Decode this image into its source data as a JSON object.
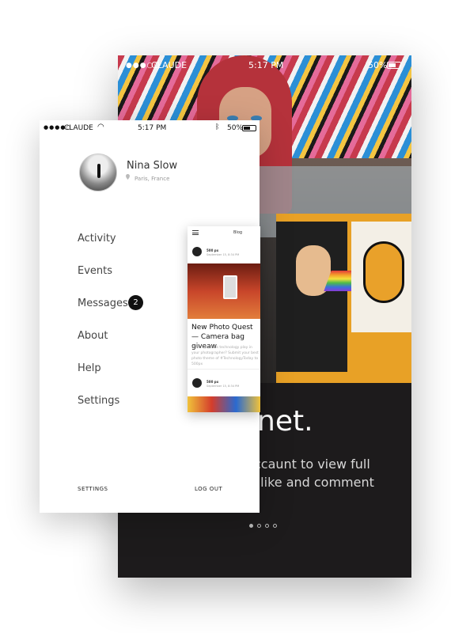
{
  "back_phone": {
    "status": {
      "carrier": "CLAUDE",
      "time": "5:17 PM",
      "battery": "50%"
    },
    "headline": "net.",
    "subline": "ccaunt to view full\n, like and comment",
    "pager": {
      "count": 4,
      "active": 0
    }
  },
  "front_phone": {
    "status": {
      "carrier": "CLAUDE",
      "time": "5:17 PM",
      "battery": "50%"
    },
    "profile": {
      "name": "Nina Slow",
      "location": "Paris, France"
    },
    "menu": [
      {
        "label": "Activity"
      },
      {
        "label": "Events"
      },
      {
        "label": "Messages",
        "badge": "2"
      },
      {
        "label": "About"
      },
      {
        "label": "Help"
      },
      {
        "label": "Settings"
      }
    ],
    "footer": {
      "settings": "SETTINGS",
      "logout": "LOG OUT"
    }
  },
  "blog_card": {
    "title": "Blog",
    "post1": {
      "points": "500 px",
      "date": "September 15, 8:34 PM"
    },
    "post_title": "New Photo Quest — Camera bag giveaw",
    "post_desc": "What role does technology play in your photographer? Submit your best photo theme of #TechnologyToday to 500px",
    "post2": {
      "points": "500 px",
      "date": "September 15, 8:34 PM"
    }
  },
  "colors": {
    "accent": "#111111",
    "back_bg": "#1d1b1c"
  }
}
